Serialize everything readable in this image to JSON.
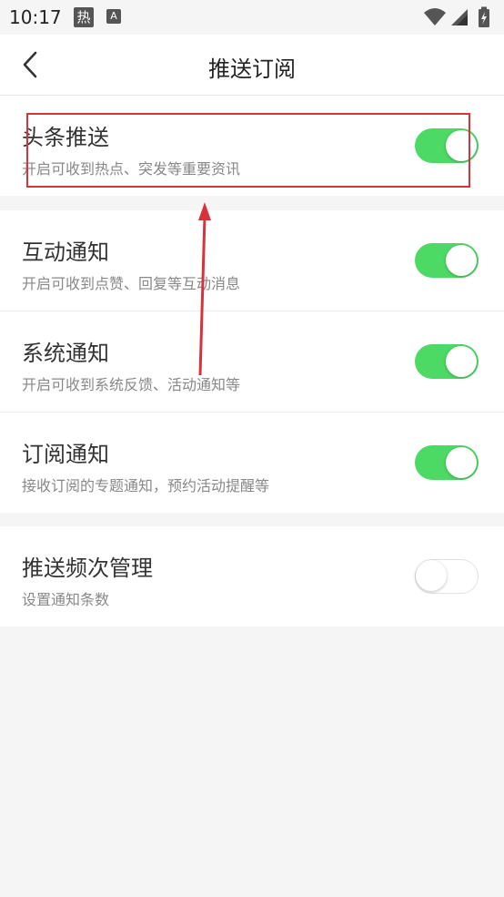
{
  "status_bar": {
    "time": "10:17",
    "hot_badge": "热",
    "a_badge": "A",
    "icons": [
      "wifi-icon",
      "cell-signal-icon",
      "battery-icon"
    ]
  },
  "header": {
    "title": "推送订阅",
    "back_icon": "chevron-left-icon"
  },
  "groups": [
    {
      "items": [
        {
          "title": "头条推送",
          "subtitle": "开启可收到热点、突发等重要资讯",
          "enabled": true
        }
      ]
    },
    {
      "items": [
        {
          "title": "互动通知",
          "subtitle": "开启可收到点赞、回复等互动消息",
          "enabled": true
        },
        {
          "title": "系统通知",
          "subtitle": "开启可收到系统反馈、活动通知等",
          "enabled": true
        },
        {
          "title": "订阅通知",
          "subtitle": "接收订阅的专题通知，预约活动提醒等",
          "enabled": true
        }
      ]
    },
    {
      "items": [
        {
          "title": "推送频次管理",
          "subtitle": "设置通知条数",
          "enabled": false
        }
      ]
    }
  ],
  "colors": {
    "toggle_on": "#4cd964",
    "annotation": "#d8333b",
    "background": "#f5f5f5"
  }
}
